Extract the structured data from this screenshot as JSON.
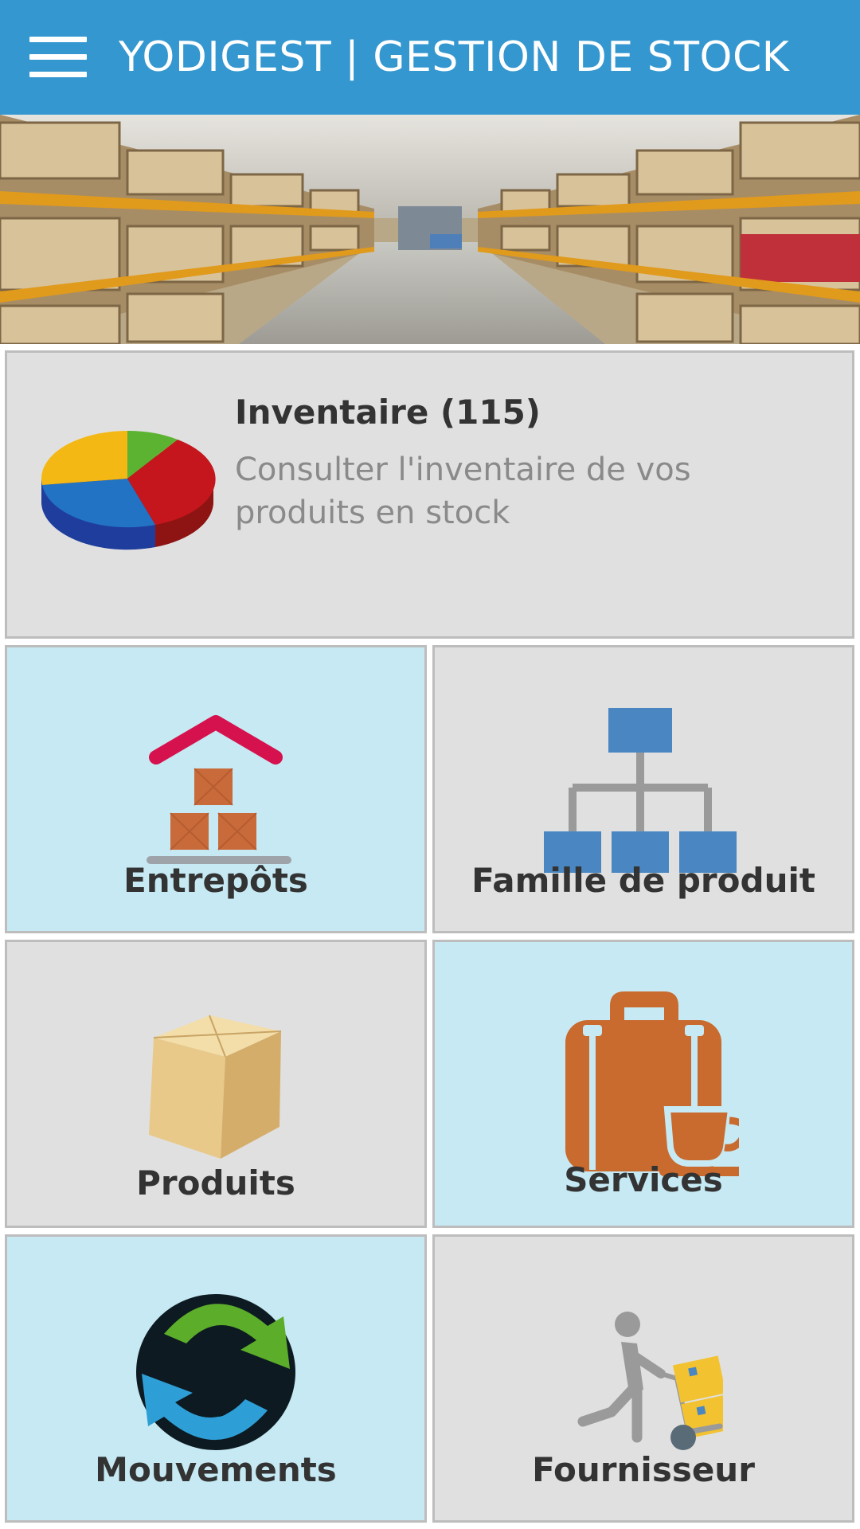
{
  "app_bar": {
    "title": "YODIGEST | GESTION DE STOCK",
    "menu_icon": "hamburger-menu-icon",
    "background": "#3497cf"
  },
  "inventory_card": {
    "title": "Inventaire  (115)",
    "description": "Consulter l'inventaire de vos produits en stock",
    "icon": "pie-chart-icon"
  },
  "tiles": [
    {
      "label": "Entrepôts",
      "icon": "warehouse-icon",
      "background": "#c6e9f3"
    },
    {
      "label": "Famille de produit",
      "icon": "hierarchy-icon",
      "background": "#e0e0e0"
    },
    {
      "label": "Produits",
      "icon": "box-icon",
      "background": "#e0e0e0"
    },
    {
      "label": "Services",
      "icon": "briefcase-coffee-icon",
      "background": "#c6e9f3"
    },
    {
      "label": "Mouvements",
      "icon": "sync-arrows-icon",
      "background": "#c6e9f3"
    },
    {
      "label": "Fournisseur",
      "icon": "delivery-person-icon",
      "background": "#e0e0e0"
    }
  ]
}
